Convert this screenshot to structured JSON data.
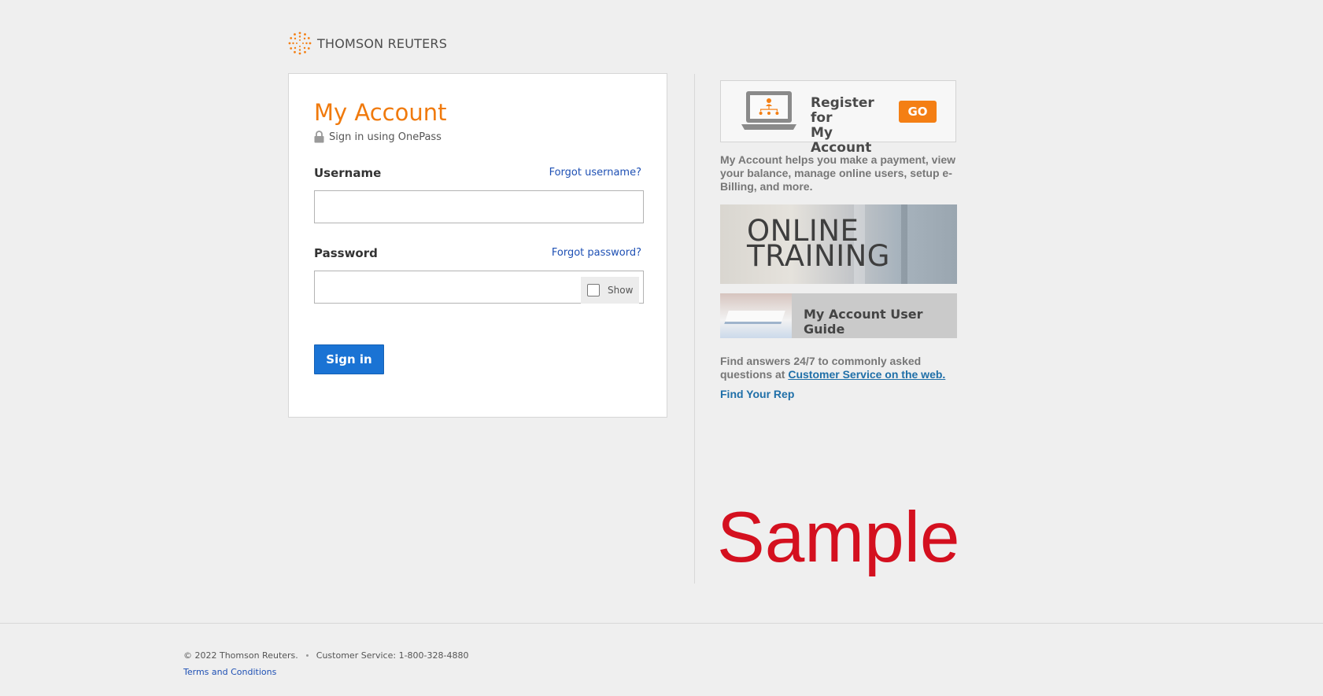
{
  "brand": {
    "name": "THOMSON REUTERS",
    "logo_icon": "thomson-reuters-dot-logo",
    "accent_color": "#f07a0d"
  },
  "login": {
    "title": "My Account",
    "subtitle": "Sign in using OnePass",
    "username_label": "Username",
    "forgot_username": "Forgot username?",
    "username_value": "",
    "password_label": "Password",
    "forgot_password": "Forgot password?",
    "password_value": "",
    "show_label": "Show",
    "show_checked": false,
    "signin_label": "Sign in",
    "signin_color": "#1a73d4"
  },
  "sidebar": {
    "register_line1": "Register for",
    "register_line2": "My Account",
    "go_label": "GO",
    "info_text": "My Account helps you make a payment, view your balance, manage online users, setup e-Billing, and more.",
    "training_line1": "ONLINE",
    "training_line2": "TRAINING",
    "guide_label": "My Account User Guide",
    "answers_text": "Find answers 24/7 to commonly asked questions at",
    "answers_link": "Customer Service on the web.",
    "find_rep": "Find Your Rep"
  },
  "watermark": "Sample",
  "footer": {
    "copyright": "© 2022 Thomson Reuters.",
    "customer_service": "Customer Service: 1-800-328-4880",
    "terms": "Terms and Conditions"
  }
}
